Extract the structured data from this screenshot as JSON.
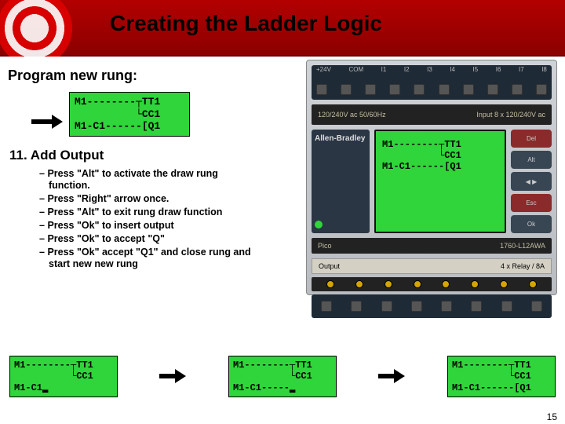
{
  "title": "Creating the Ladder Logic",
  "subhead": "Program new rung:",
  "lcd_small": "M1--------┬TT1\n          └CC1\nM1-C1------[Q1",
  "section": "11. Add Output",
  "bullets": [
    "Press \"Alt\" to activate the draw rung function.",
    "Press \"Right\" arrow once.",
    "Press \"Alt\" to exit rung draw function",
    "Press \"Ok\" to insert output",
    "Press \"Ok\" to accept \"Q\"",
    "Press \"Ok\" accept \"Q1\" and close rung and start new new rung"
  ],
  "plc": {
    "top_labels": [
      "+24V",
      "COM",
      "I1",
      "I2",
      "I3",
      "I4",
      "I5",
      "I6",
      "I7",
      "I8"
    ],
    "strip_left": "120/240V ac\n50/60Hz",
    "strip_right": "Input 8 x 120/240V ac",
    "brand": "Allen-Bradley",
    "brand_model": "Pico",
    "model_number": "1760-L12AWA",
    "btn_del": "Del",
    "btn_alt": "Alt",
    "btn_nav": "◀ ▶",
    "btn_esc": "Esc",
    "btn_ok": "Ok",
    "screen": "M1--------┬TT1\n          └CC1\nM1-C1------[Q1",
    "out_left": "Output",
    "out_right": "4 x Relay / 8A"
  },
  "bottom_lcds": [
    "M1--------┬TT1\n          └CC1\nM1-C1▂",
    "M1--------┬TT1\n          └CC1\nM1-C1-----▂",
    "M1--------┬TT1\n          └CC1\nM1-C1------[Q1"
  ],
  "page_number": "15"
}
